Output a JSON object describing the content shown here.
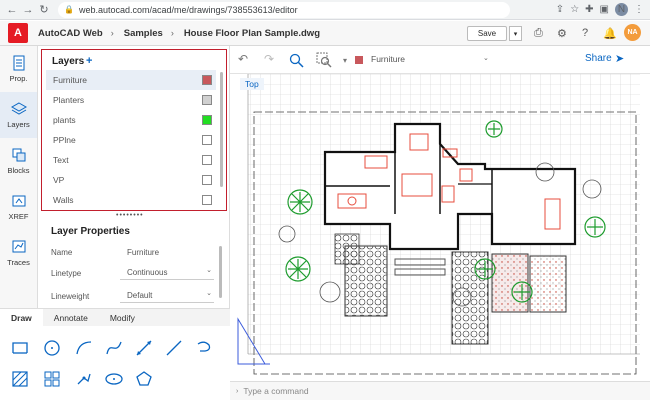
{
  "browser": {
    "url": "web.autocad.com/acad/me/drawings/738553613/editor",
    "profile_initial": "N"
  },
  "app": {
    "logo": "A",
    "name": "AutoCAD Web",
    "breadcrumb": [
      "Samples",
      "House Floor Plan Sample.dwg"
    ],
    "save_label": "Save",
    "user_initials": "NA"
  },
  "leftbar": {
    "items": [
      {
        "label": "Prop.",
        "icon": "properties-icon"
      },
      {
        "label": "Layers",
        "icon": "layers-icon"
      },
      {
        "label": "Blocks",
        "icon": "blocks-icon"
      },
      {
        "label": "XREF",
        "icon": "xref-icon"
      },
      {
        "label": "Traces",
        "icon": "traces-icon"
      }
    ]
  },
  "layers": {
    "title": "Layers",
    "add_symbol": "+",
    "items": [
      {
        "name": "Furniture",
        "color": "#c8585c",
        "selected": true
      },
      {
        "name": "Planters",
        "color": "#d0d0d0"
      },
      {
        "name": "plants",
        "color": "#22dd22"
      },
      {
        "name": "PPlne",
        "color": "#ffffff"
      },
      {
        "name": "Text",
        "color": "#ffffff"
      },
      {
        "name": "VP",
        "color": "#ffffff"
      },
      {
        "name": "Walls",
        "color": "#ffffff"
      }
    ]
  },
  "properties": {
    "title": "Layer Properties",
    "name_label": "Name",
    "name_value": "Furniture",
    "linetype_label": "Linetype",
    "linetype_value": "Continuous",
    "lineweight_label": "Lineweight",
    "lineweight_value": "Default"
  },
  "tabs": [
    "Draw",
    "Annotate",
    "Modify"
  ],
  "canvas": {
    "current_layer": "Furniture",
    "current_layer_color": "#c8585c",
    "share_label": "Share",
    "view_label": "Top"
  },
  "command_line": {
    "placeholder": "Type a command"
  }
}
